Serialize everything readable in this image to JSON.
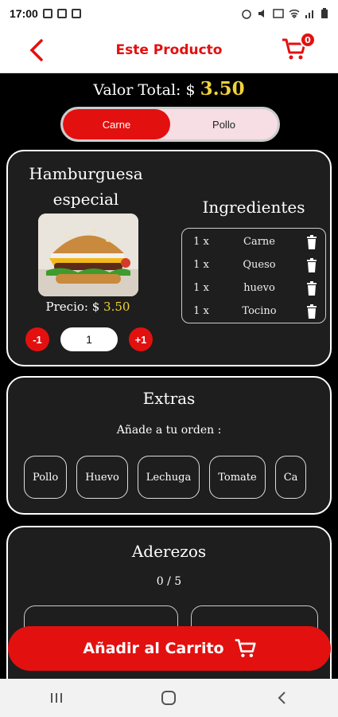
{
  "status_bar": {
    "time": "17:00"
  },
  "header": {
    "title": "Este Producto",
    "cart_count": "0"
  },
  "total": {
    "label": "Valor Total: $",
    "amount": "3.50"
  },
  "toggle": {
    "options": [
      {
        "label": "Carne",
        "active": true
      },
      {
        "label": "Pollo",
        "active": false
      }
    ]
  },
  "product": {
    "name_line1": "Hamburguesa",
    "name_line2": "especial",
    "price_label": "Precio: $",
    "price_value": "3.50",
    "qty_minus": "-1",
    "qty_value": "1",
    "qty_plus": "+1"
  },
  "ingredients": {
    "title": "Ingredientes",
    "items": [
      {
        "qty": "1 x",
        "name": "Carne"
      },
      {
        "qty": "1 x",
        "name": "Queso"
      },
      {
        "qty": "1 x",
        "name": "huevo"
      },
      {
        "qty": "1 x",
        "name": "Tocino"
      }
    ]
  },
  "extras": {
    "title": "Extras",
    "subtitle": "Añade a tu orden :",
    "items": [
      "Pollo",
      "Huevo",
      "Lechuga",
      "Tomate",
      "Ca"
    ]
  },
  "aderezos": {
    "title": "Aderezos",
    "count": "0 / 5"
  },
  "add_to_cart": {
    "label": "Añadir al Carrito"
  },
  "colors": {
    "accent": "#e31010",
    "price": "#f1d23a",
    "card_bg": "#1e1e1e"
  }
}
